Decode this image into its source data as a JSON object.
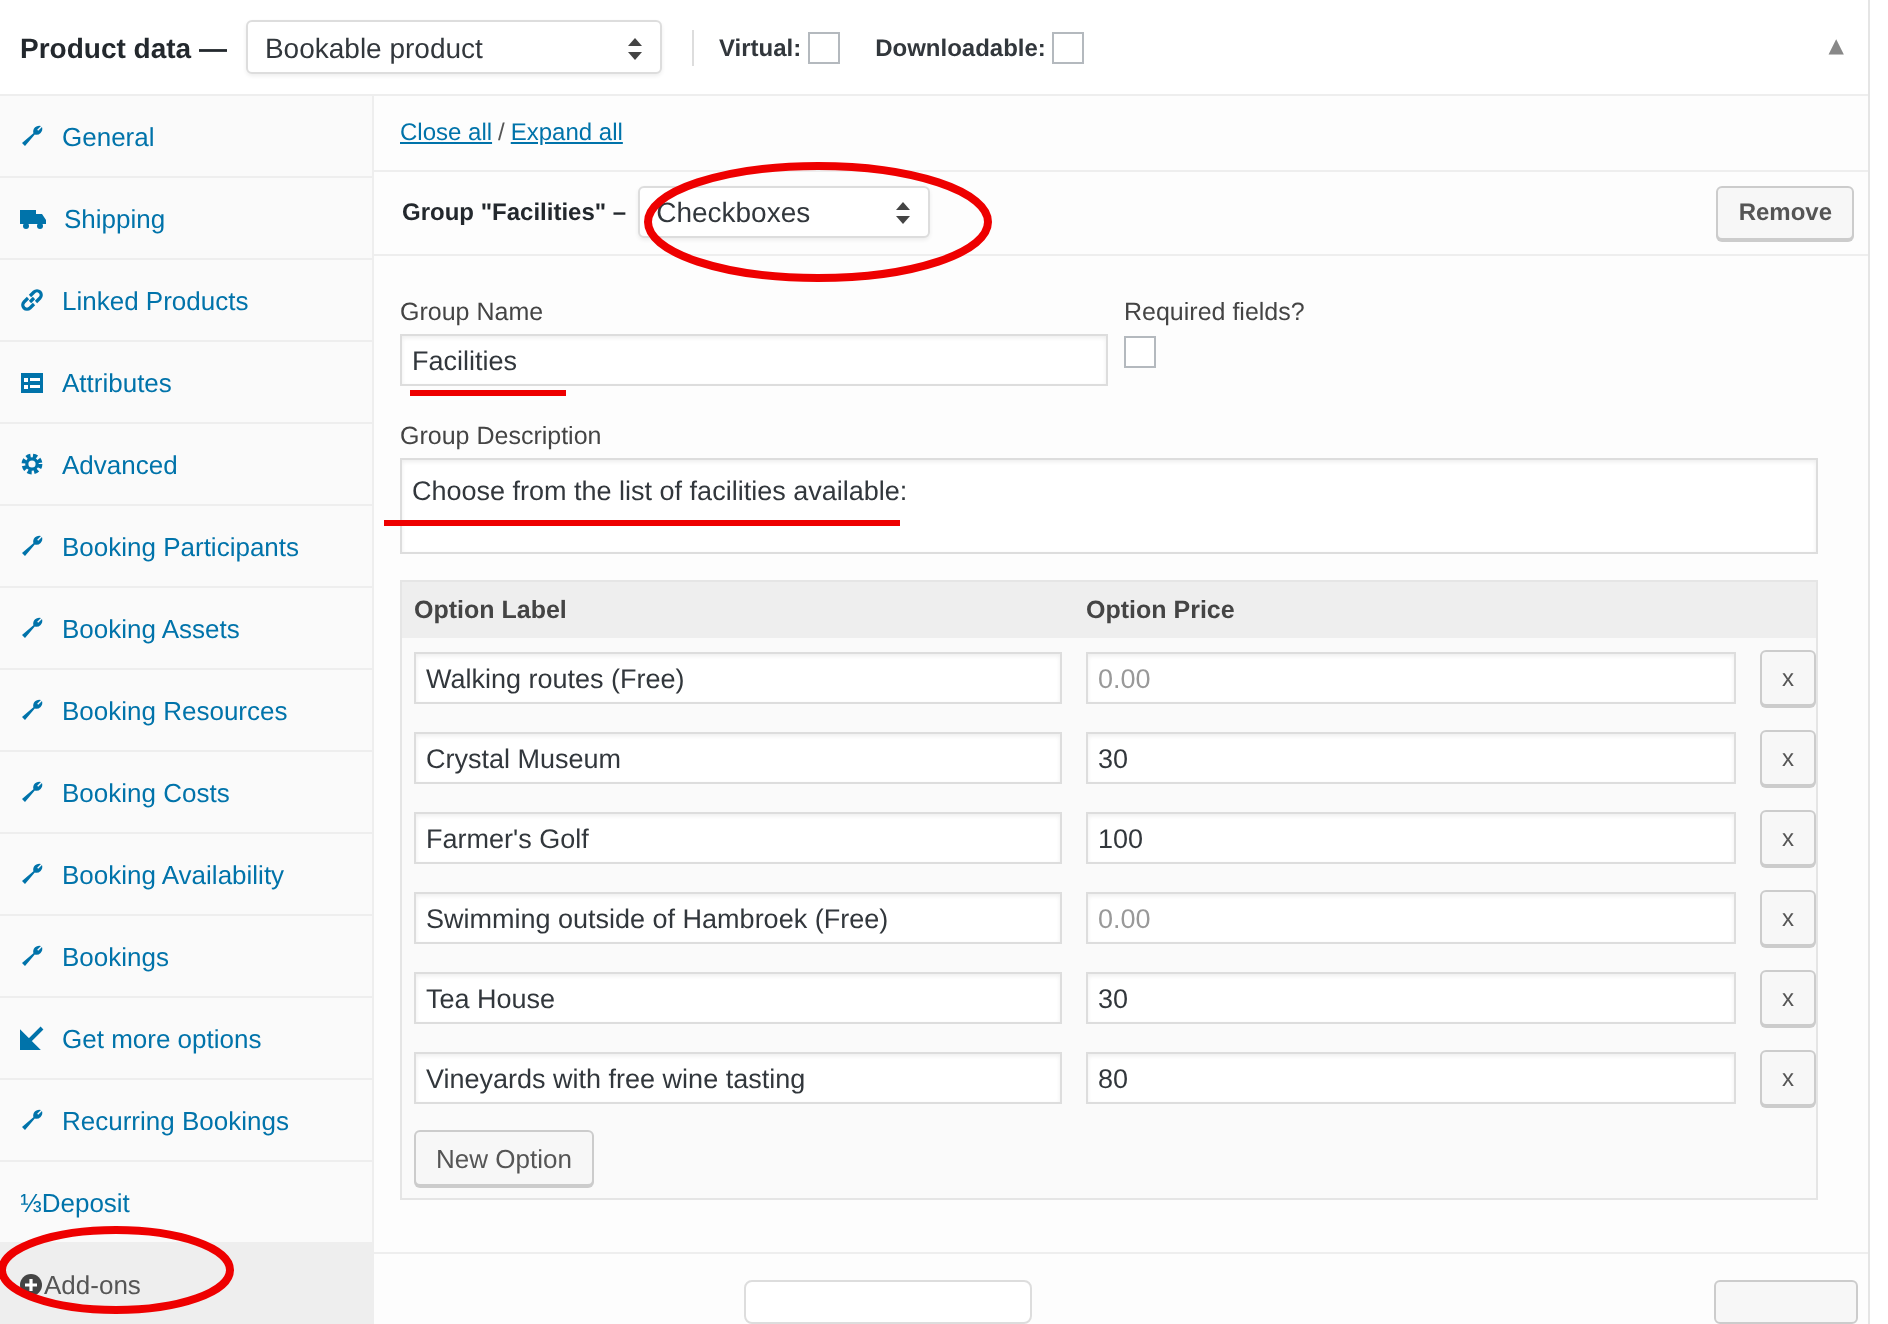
{
  "header": {
    "title": "Product data —",
    "product_type": "Bookable product",
    "virtual": {
      "label": "Virtual:",
      "checked": false
    },
    "downloadable": {
      "label": "Downloadable:",
      "checked": false
    },
    "collapse_glyph": "▲"
  },
  "sidebar": {
    "items": [
      {
        "label": "General",
        "kind": "wrench",
        "selected": false
      },
      {
        "label": "Shipping",
        "kind": "truck",
        "selected": false
      },
      {
        "label": "Linked Products",
        "kind": "link",
        "selected": false
      },
      {
        "label": "Attributes",
        "kind": "list",
        "selected": false
      },
      {
        "label": "Advanced",
        "kind": "gear",
        "selected": false
      },
      {
        "label": "Booking Participants",
        "kind": "wrench",
        "selected": false
      },
      {
        "label": "Booking Assets",
        "kind": "wrench",
        "selected": false
      },
      {
        "label": "Booking Resources",
        "kind": "wrench",
        "selected": false
      },
      {
        "label": "Booking Costs",
        "kind": "wrench",
        "selected": false
      },
      {
        "label": "Booking Availability",
        "kind": "wrench",
        "selected": false
      },
      {
        "label": "Bookings",
        "kind": "wrench",
        "selected": false
      },
      {
        "label": "Get more options",
        "kind": "arrow",
        "selected": false
      },
      {
        "label": "Recurring Bookings",
        "kind": "wrench",
        "selected": false
      },
      {
        "label": "⅓Deposit",
        "kind": "plain",
        "selected": false
      },
      {
        "label": "Add-ons",
        "kind": "plus",
        "selected": true
      }
    ]
  },
  "links": {
    "close_all": "Close all",
    "separator": "/",
    "expand_all": "Expand all"
  },
  "group": {
    "title": "Group \"Facilities\" –",
    "type": "Checkboxes",
    "remove": "Remove",
    "name_label": "Group Name",
    "name_value": "Facilities",
    "required_label": "Required fields?",
    "required": false,
    "description_label": "Group Description",
    "description_value": "Choose from the list of facilities available:",
    "table": {
      "columns": [
        "Option Label",
        "Option Price"
      ],
      "rows": [
        {
          "label": "Walking routes (Free)",
          "price_placeholder": "0.00",
          "remove": "x"
        },
        {
          "label": "Crystal Museum",
          "price": "30",
          "remove": "x"
        },
        {
          "label": "Farmer's Golf",
          "price": "100",
          "remove": "x"
        },
        {
          "label": "Swimming outside of Hambroek (Free)",
          "price_placeholder": "0.00",
          "remove": "x"
        },
        {
          "label": "Tea House",
          "price": "30",
          "remove": "x"
        },
        {
          "label": "Vineyards with free wine tasting",
          "price": "80",
          "remove": "x"
        }
      ]
    },
    "new_option": "New Option"
  }
}
